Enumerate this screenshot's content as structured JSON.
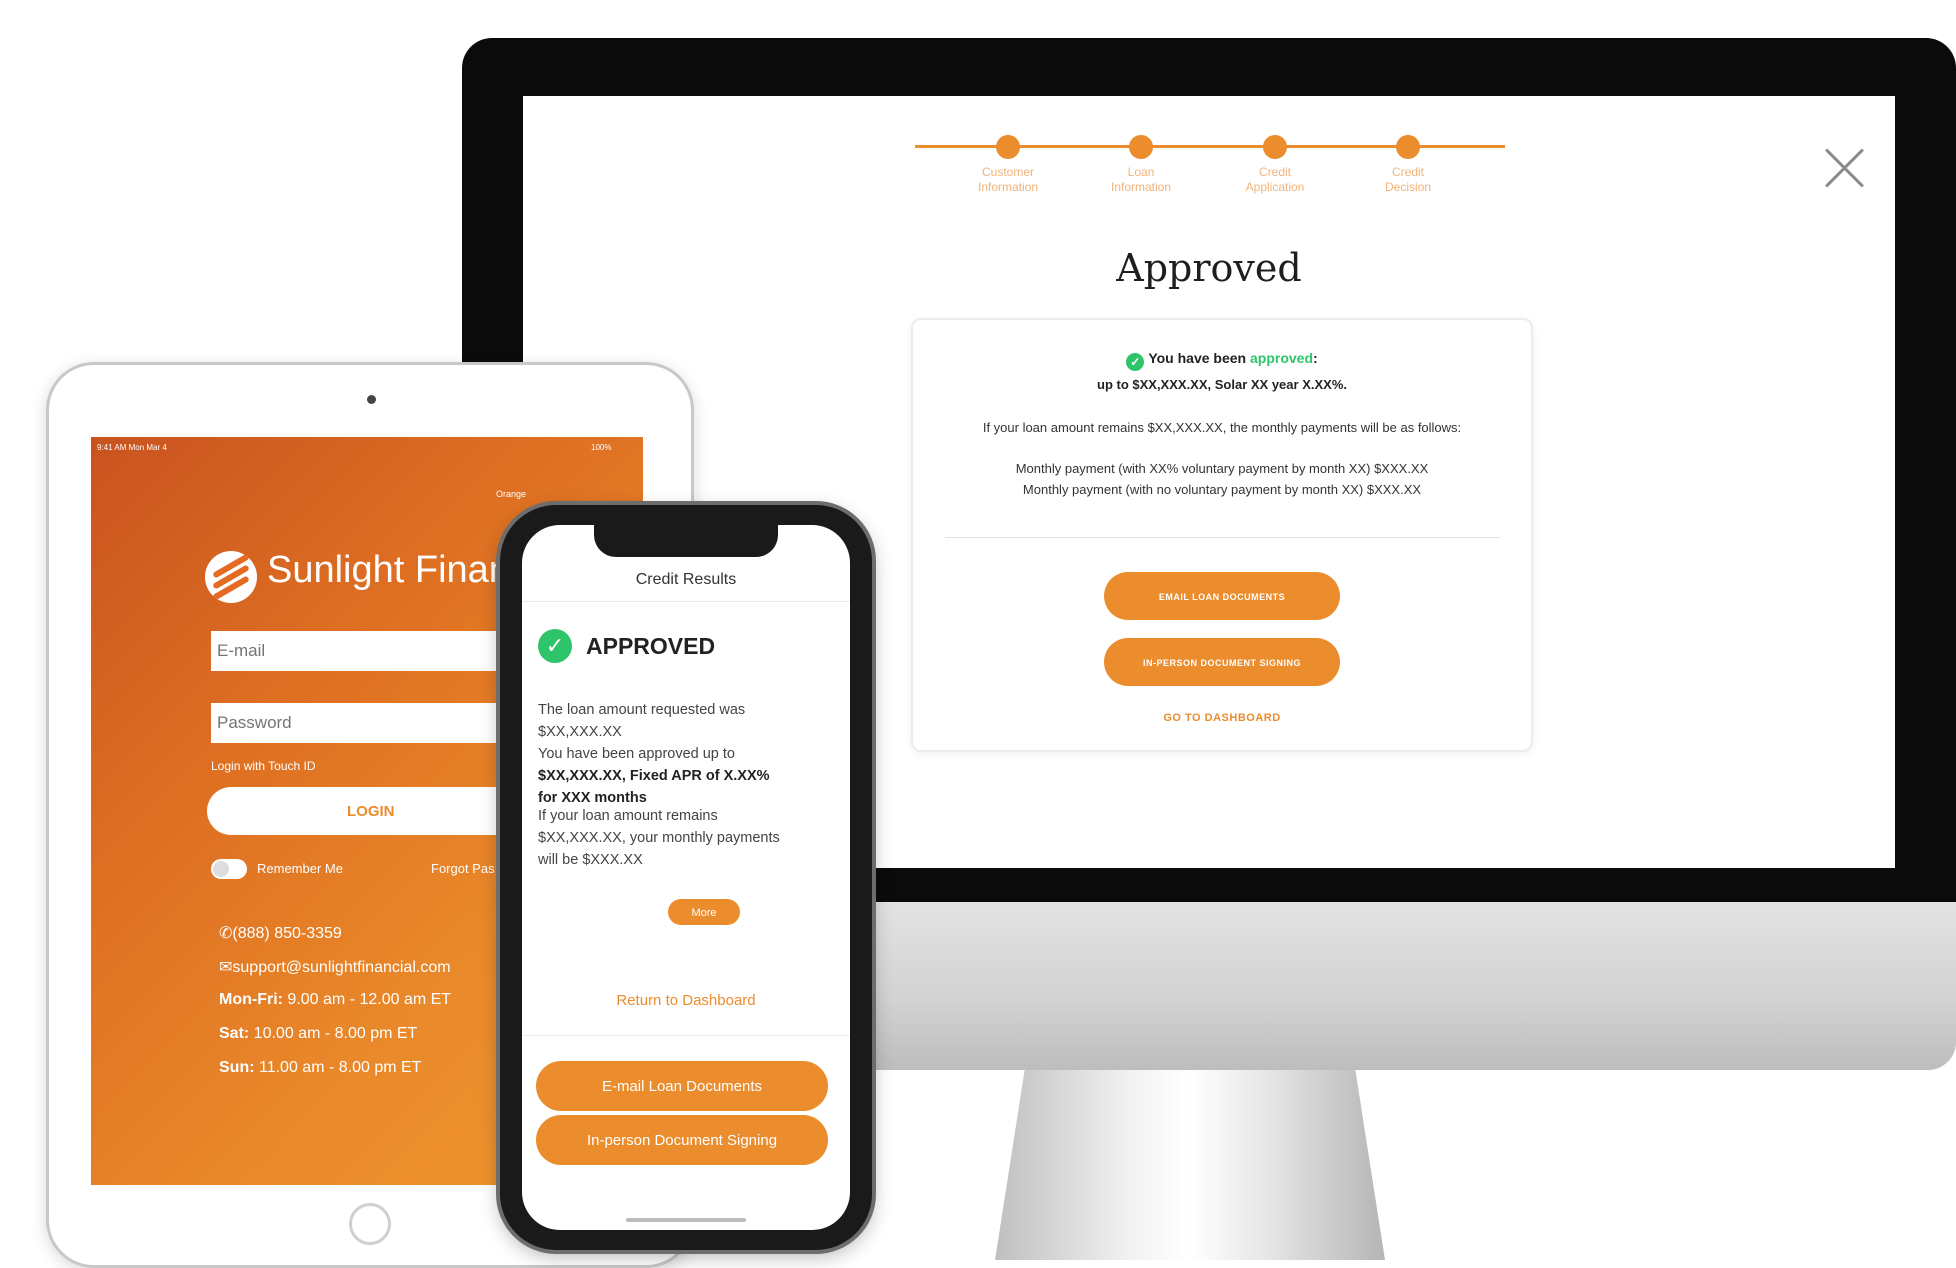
{
  "desktop": {
    "steps": [
      {
        "line1": "Customer",
        "line2": "Information"
      },
      {
        "line1": "Loan",
        "line2": "Information"
      },
      {
        "line1": "Credit",
        "line2": "Application"
      },
      {
        "line1": "Credit",
        "line2": "Decision"
      }
    ],
    "heading": "Approved",
    "card": {
      "line1_prefix": "You have been ",
      "line1_highlight": "approved",
      "line1_suffix": ":",
      "line2": "up to $XX,XXX.XX, Solar XX year X.XX%.",
      "line3": "If your loan amount remains $XX,XXX.XX, the monthly payments will be as follows:",
      "line4": "Monthly payment (with XX% voluntary payment by month XX) $XXX.XX",
      "line5": "Monthly payment (with no voluntary payment by month XX) $XXX.XX",
      "email_button": "EMAIL LOAN DOCUMENTS",
      "inperson_button": "IN-PERSON DOCUMENT SIGNING",
      "dashboard_link": "GO TO DASHBOARD"
    }
  },
  "tablet": {
    "status_left": "9:41 AM  Mon Mar 4",
    "status_right": "100%",
    "logo_text": "Sunlight Financ",
    "logo_sub": "Orange",
    "email_placeholder": "E-mail",
    "password_placeholder": "Password",
    "touch_id": "Login with Touch ID",
    "login_button": "LOGIN",
    "remember_me": "Remember Me",
    "forgot": "Forgot Pas",
    "phone": "(888) 850-3359",
    "email": "support@sunlightfinancial.com",
    "hours": [
      {
        "day": "Mon-Fri:",
        "time": " 9.00 am - 12.00 am ET"
      },
      {
        "day": "Sat:",
        "time": " 10.00 am - 8.00 pm ET"
      },
      {
        "day": "Sun:",
        "time": " 11.00 am - 8.00 pm ET"
      }
    ]
  },
  "phone": {
    "title": "Credit Results",
    "approved": "APPROVED",
    "requested_line1": "The loan amount requested was",
    "requested_line2": "$XX,XXX.XX",
    "approved_line1": "You have been approved up to",
    "approved_line2": "$XX,XXX.XX, Fixed APR of X.XX%",
    "approved_line3": "for XXX months",
    "remains_line1": "If your loan amount remains",
    "remains_line2": "$XX,XXX.XX, your monthly payments",
    "remains_line3": "will be $XXX.XX",
    "more_button": "More",
    "return_link": "Return to Dashboard",
    "email_button": "E-mail Loan Documents",
    "inperson_button": "In-person Document Signing"
  },
  "colors": {
    "accent": "#eb8c2d",
    "approved_green": "#2ec46a",
    "tablet_gradient_start": "#c95320",
    "tablet_gradient_end": "#ee9630"
  }
}
